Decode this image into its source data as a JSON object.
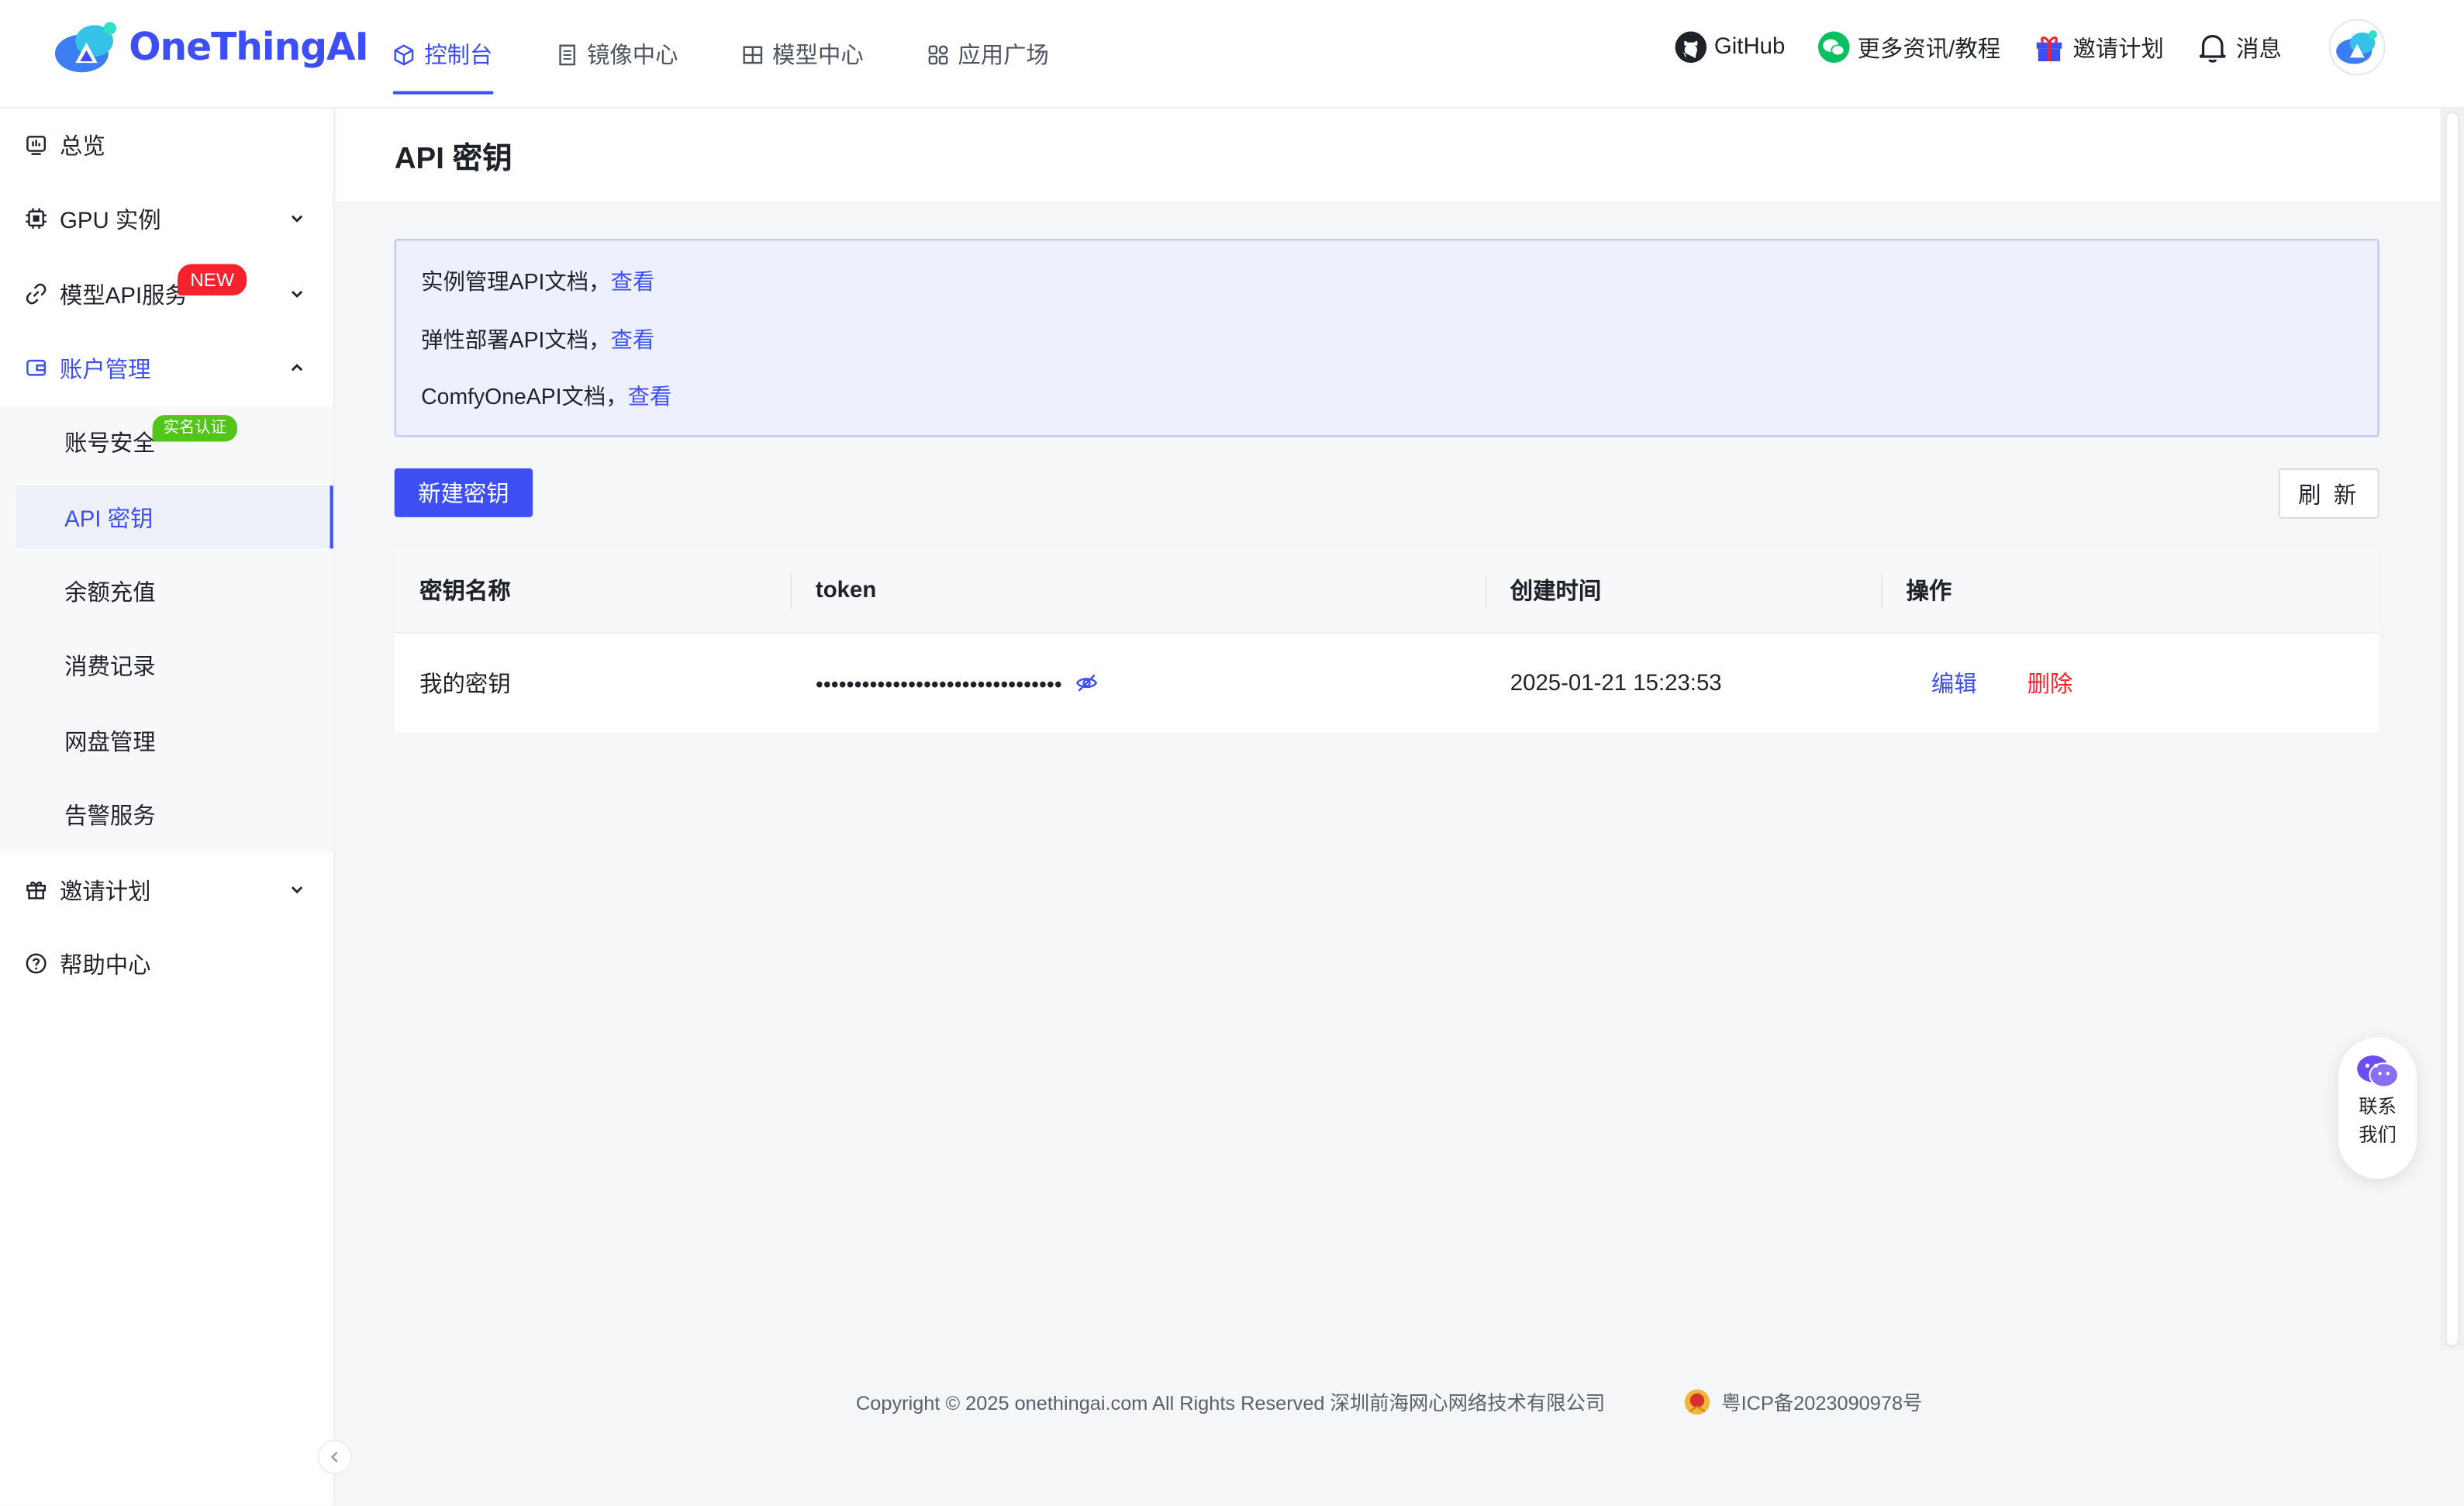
{
  "brand": {
    "name": "OneThingAI",
    "accent": "#3d4ff2"
  },
  "topnav": [
    {
      "label": "控制台",
      "icon": "cube-icon",
      "active": true
    },
    {
      "label": "镜像中心",
      "icon": "document-icon"
    },
    {
      "label": "模型中心",
      "icon": "grid-icon"
    },
    {
      "label": "应用广场",
      "icon": "apps-icon"
    }
  ],
  "topright": {
    "github": "GitHub",
    "news": "更多资讯/教程",
    "invite": "邀请计划",
    "messages": "消息"
  },
  "sidebar": {
    "overview": "总览",
    "gpu": "GPU 实例",
    "model_api": "模型API服务",
    "model_api_badge": "NEW",
    "account": "账户管理",
    "sub": [
      {
        "label": "账号安全",
        "badge": "实名认证"
      },
      {
        "label": "API 密钥",
        "active": true
      },
      {
        "label": "余额充值"
      },
      {
        "label": "消费记录"
      },
      {
        "label": "网盘管理"
      },
      {
        "label": "告警服务"
      }
    ],
    "invite": "邀请计划",
    "help": "帮助中心"
  },
  "page": {
    "title": "API 密钥",
    "info": [
      {
        "text": "实例管理API文档，",
        "link": "查看"
      },
      {
        "text": "弹性部署API文档，",
        "link": "查看"
      },
      {
        "text": "ComfyOneAPI文档，",
        "link": "查看"
      }
    ],
    "new_button": "新建密钥",
    "refresh_button": "刷 新"
  },
  "table": {
    "headers": [
      "密钥名称",
      "token",
      "创建时间",
      "操作"
    ],
    "rows": [
      {
        "name": "我的密钥",
        "token": "••••••••••••••••••••••••••••••••",
        "created": "2025-01-21 15:23:53",
        "edit": "编辑",
        "delete": "删除"
      }
    ]
  },
  "footer": {
    "copyright": "Copyright © 2025 onethingai.com All Rights Reserved 深圳前海网心网络技术有限公司",
    "icp": "粤ICP备2023090978号"
  },
  "contact": {
    "line1": "联系",
    "line2": "我们"
  }
}
